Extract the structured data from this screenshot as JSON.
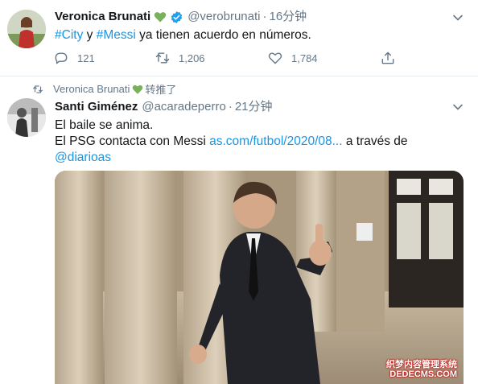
{
  "tweet1": {
    "name": "Veronica Brunati",
    "handle": "@verobrunati",
    "separator": "·",
    "time": "16分钟",
    "text_parts": [
      "#City",
      " y ",
      "#Messi",
      " ya tienen acuerdo en números."
    ],
    "reply_count": "121",
    "retweet_count": "1,206",
    "like_count": "1,784"
  },
  "retweet_banner": {
    "name": "Veronica Brunati",
    "label": "转推了"
  },
  "tweet2": {
    "name": "Santi Giménez",
    "handle": "@acaradeperro",
    "separator": "·",
    "time": "21分钟",
    "line1": "El baile se anima.",
    "line2_prefix": "El PSG contacta con Messi ",
    "line2_link": "as.com/futbol/2020/08...",
    "line2_suffix": " a través de",
    "line3_link": "@diarioas"
  },
  "watermark": {
    "line1": "织梦内容管理系统",
    "line2": "DEDECMS.COM"
  },
  "colors": {
    "link": "#1b95e0",
    "secondary_text": "#657786",
    "verified": "#1da1f2",
    "green_heart": "#78b159"
  }
}
